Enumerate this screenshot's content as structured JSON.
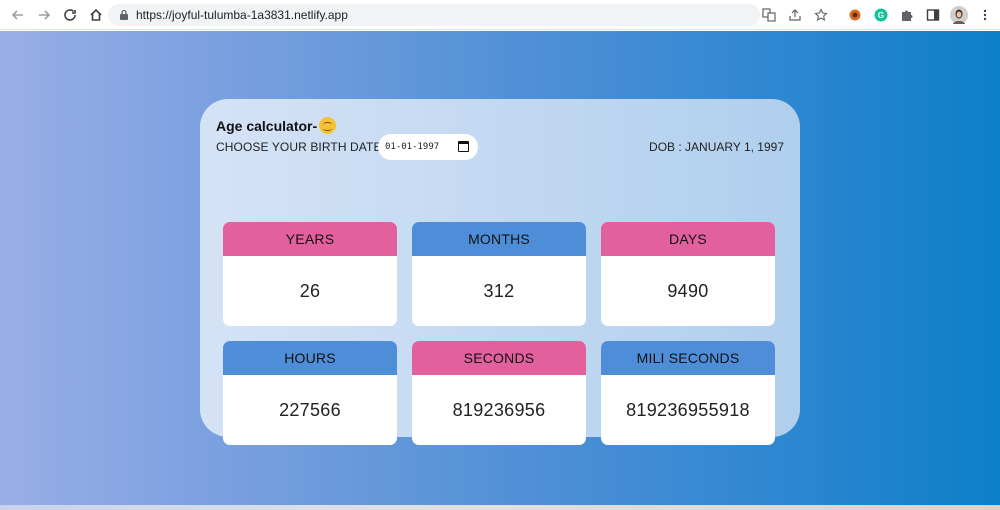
{
  "browser": {
    "url": "https://joyful-tulumba-1a3831.netlify.app"
  },
  "app": {
    "title": "Age calculator-",
    "choose_label": "CHOOSE YOUR BIRTH DATE",
    "date_value": "01-01-1997",
    "dob_text": "DOB : JANUARY 1, 1997"
  },
  "tiles": [
    {
      "label": "YEARS",
      "value": "26",
      "color": "#e2609e"
    },
    {
      "label": "MONTHS",
      "value": "312",
      "color": "#4e8ed9"
    },
    {
      "label": "DAYS",
      "value": "9490",
      "color": "#e2609e"
    },
    {
      "label": "HOURS",
      "value": "227566",
      "color": "#4e8ed9"
    },
    {
      "label": "SECONDS",
      "value": "819236956",
      "color": "#e2609e"
    },
    {
      "label": "MILI SECONDS",
      "value": "819236955918",
      "color": "#4e8ed9"
    }
  ],
  "icons": {
    "back": "arrow-left-icon",
    "forward": "arrow-right-icon",
    "reload": "reload-icon",
    "home": "home-icon",
    "lock": "lock-icon",
    "translate": "translate-icon",
    "share": "share-icon",
    "star": "star-icon",
    "extension1": "extension-icon",
    "grammarly": "grammarly-icon",
    "puzzle": "puzzle-icon",
    "sidepanel": "side-panel-icon",
    "avatar": "profile-avatar",
    "menu": "kebab-menu-icon",
    "emoji": "hugging-face-emoji",
    "calendar": "calendar-icon"
  }
}
